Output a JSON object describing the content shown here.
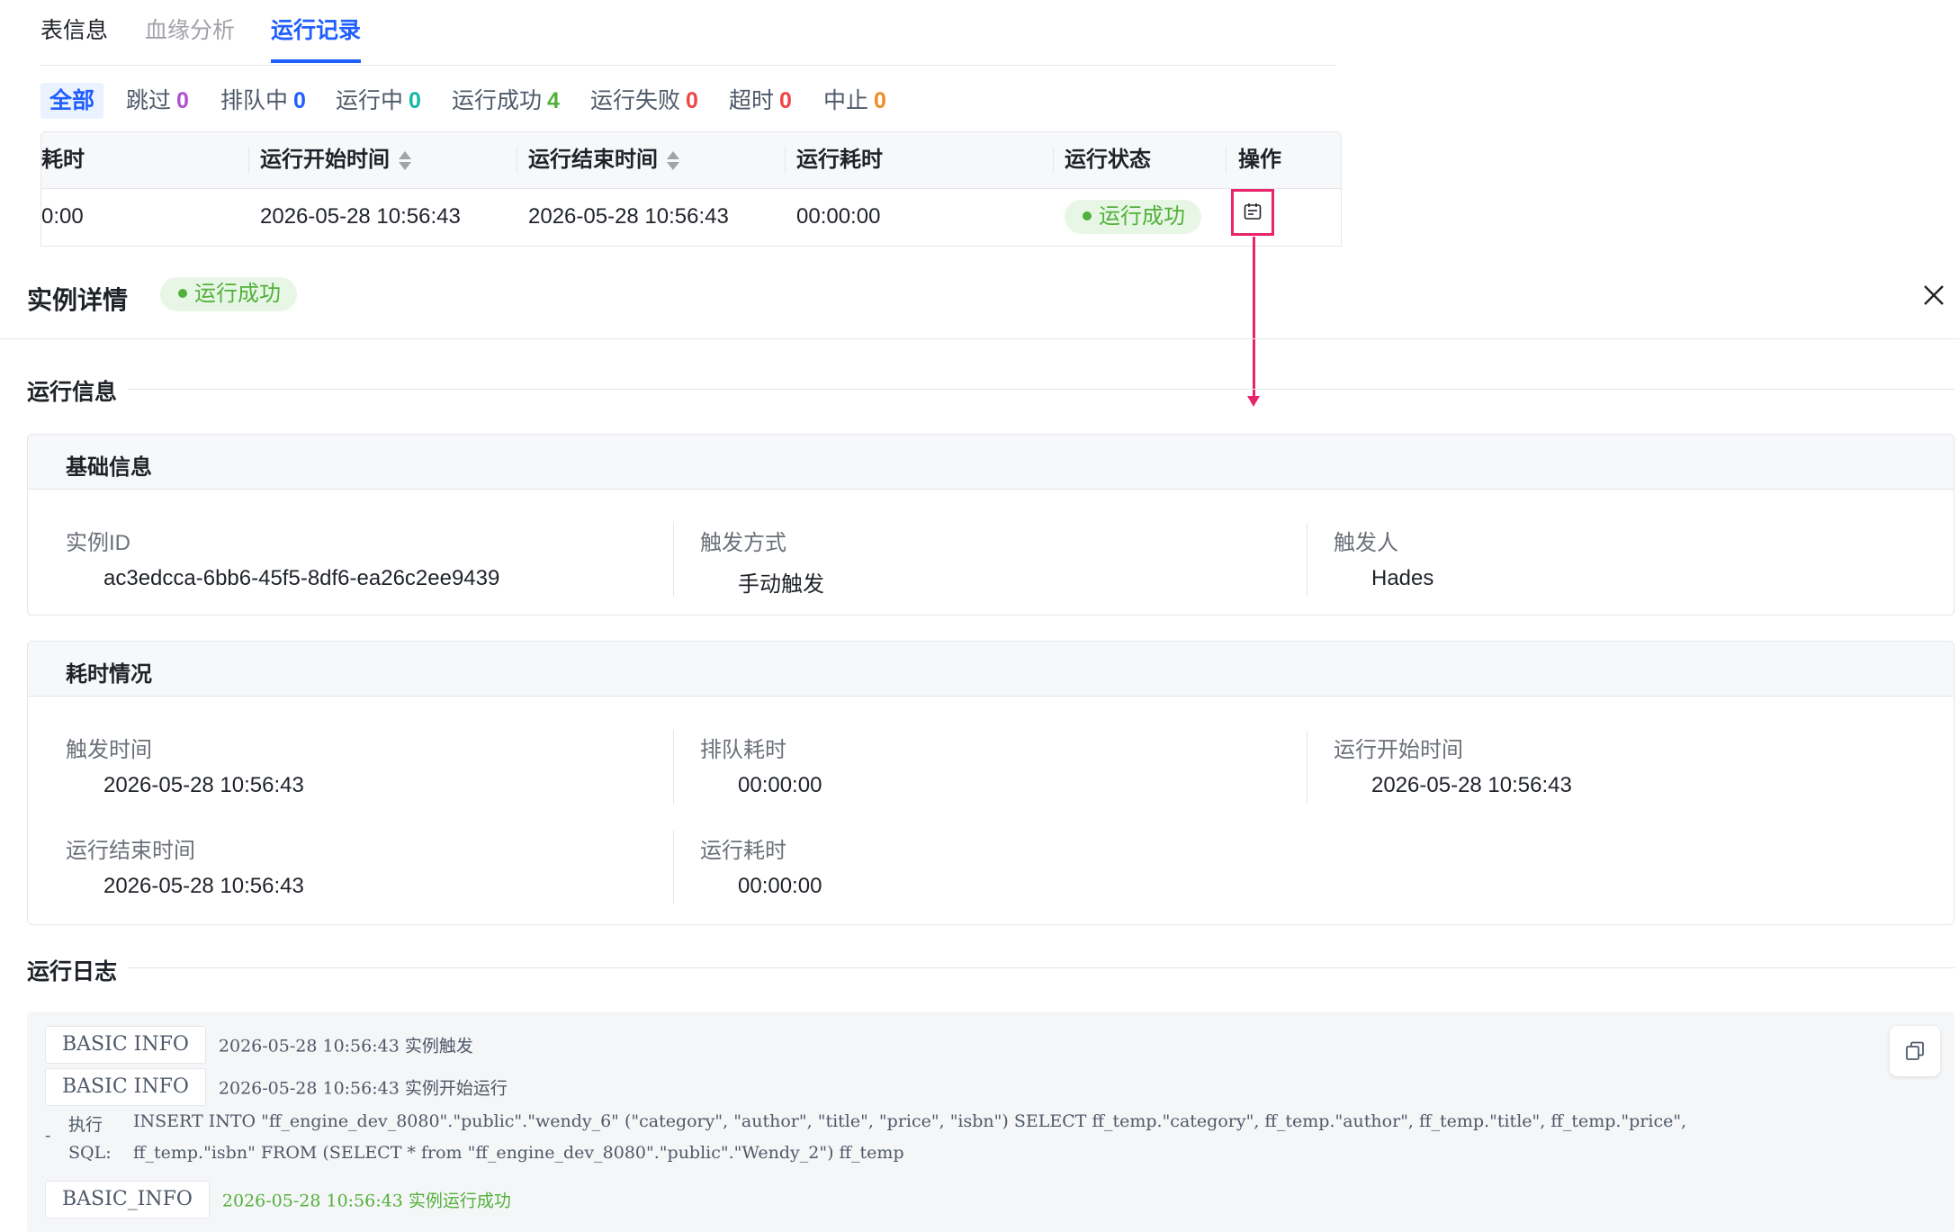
{
  "tabs": [
    {
      "label": "表信息"
    },
    {
      "label": "血缘分析"
    },
    {
      "label": "运行记录"
    }
  ],
  "filters": [
    {
      "label": "全部",
      "count": ""
    },
    {
      "label": "跳过",
      "count": "0",
      "color": "#b04fd6"
    },
    {
      "label": "排队中",
      "count": "0",
      "color": "#1f5eff"
    },
    {
      "label": "运行中",
      "count": "0",
      "color": "#14b8a6"
    },
    {
      "label": "运行成功",
      "count": "4",
      "color": "#52b03c"
    },
    {
      "label": "运行失败",
      "count": "0",
      "color": "#f04444"
    },
    {
      "label": "超时",
      "count": "0",
      "color": "#f04444"
    },
    {
      "label": "中止",
      "count": "0",
      "color": "#f08c1f"
    }
  ],
  "table": {
    "columns": [
      "耗时",
      "运行开始时间",
      "运行结束时间",
      "运行耗时",
      "运行状态",
      "操作"
    ],
    "rows": [
      {
        "wait": "0:00",
        "start": "2026-05-28 10:56:43",
        "end": "2026-05-28 10:56:43",
        "duration": "00:00:00",
        "status": "运行成功"
      }
    ]
  },
  "drawer": {
    "title": "实例详情",
    "status": "运行成功",
    "run_info_title": "运行信息",
    "basic": {
      "title": "基础信息",
      "instance_id_label": "实例ID",
      "instance_id": "ac3edcca-6bb6-45f5-8df6-ea26c2ee9439",
      "trigger_mode_label": "触发方式",
      "trigger_mode": "手动触发",
      "trigger_user_label": "触发人",
      "trigger_user": "Hades"
    },
    "timing": {
      "title": "耗时情况",
      "trigger_time_label": "触发时间",
      "trigger_time": "2026-05-28 10:56:43",
      "queue_label": "排队耗时",
      "queue": "00:00:00",
      "start_label": "运行开始时间",
      "start": "2026-05-28 10:56:43",
      "end_label": "运行结束时间",
      "end": "2026-05-28 10:56:43",
      "duration_label": "运行耗时",
      "duration": "00:00:00"
    },
    "log_title": "运行日志",
    "log": [
      {
        "badge": "BASIC INFO",
        "text": "2026-05-28 10:56:43 实例触发"
      },
      {
        "badge": "BASIC INFO",
        "text": "2026-05-28 10:56:43 实例开始运行"
      },
      {
        "marker": "-",
        "label1": "执行",
        "label2": "SQL:",
        "line1": "INSERT INTO \"ff_engine_dev_8080\".\"public\".\"wendy_6\" (\"category\", \"author\", \"title\", \"price\", \"isbn\") SELECT ff_temp.\"category\", ff_temp.\"author\", ff_temp.\"title\", ff_temp.\"price\",",
        "line2": "ff_temp.\"isbn\" FROM (SELECT * from \"ff_engine_dev_8080\".\"public\".\"Wendy_2\") ff_temp"
      },
      {
        "badge": "BASIC_INFO",
        "text": "2026-05-28 10:56:43 实例运行成功"
      }
    ]
  },
  "colors": {
    "accent": "#1f5eff",
    "success": "#52b03c",
    "highlight": "#e8246a"
  }
}
